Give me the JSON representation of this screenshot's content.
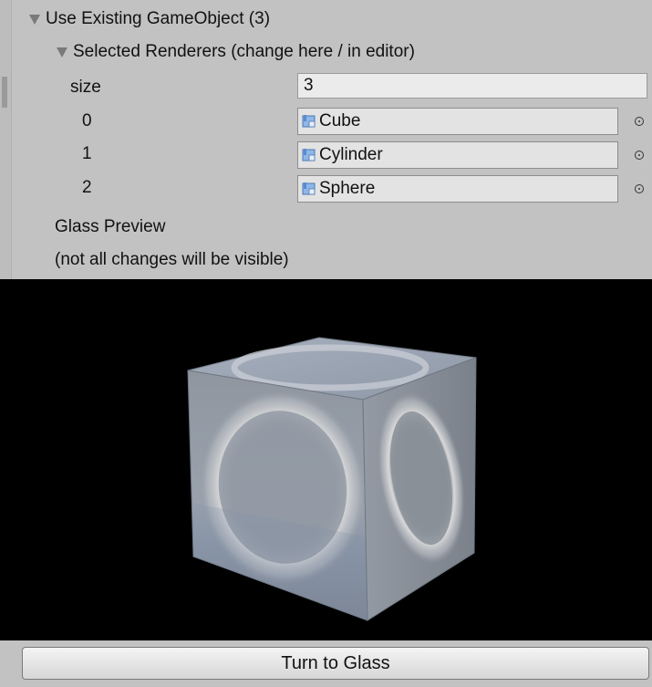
{
  "foldout": {
    "title": "Use Existing GameObject (3)"
  },
  "renderers": {
    "title": "Selected Renderers (change here / in editor)",
    "size_label": "size",
    "size_value": "3",
    "items": [
      {
        "index": "0",
        "name": "Cube"
      },
      {
        "index": "1",
        "name": "Cylinder"
      },
      {
        "index": "2",
        "name": "Sphere"
      }
    ]
  },
  "preview": {
    "title": "Glass Preview",
    "note": "(not all changes will be visible)"
  },
  "actions": {
    "turn_to_glass": "Turn to Glass"
  },
  "icons": {
    "mesh": "mesh-renderer-icon",
    "picker": "object-picker-icon",
    "foldout": "foldout-triangle-icon"
  },
  "colors": {
    "panel_background": "#c2c2c2",
    "preview_background": "#000000"
  }
}
